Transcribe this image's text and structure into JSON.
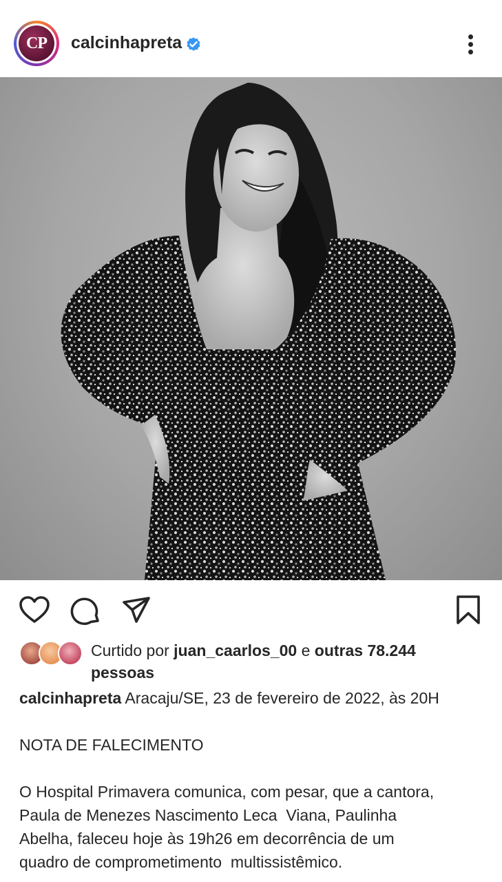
{
  "post": {
    "avatar_text": "CP",
    "username": "calcinhapreta",
    "verified_icon": "verified-badge-icon",
    "more_icon": "more-vertical-icon"
  },
  "actions": {
    "like_icon": "heart-icon",
    "comment_icon": "comment-icon",
    "share_icon": "send-icon",
    "save_icon": "bookmark-icon"
  },
  "likes": {
    "prefix": "Curtido por ",
    "user": "juan_caarlos_00",
    "middle": " e ",
    "others": "outras 78.244",
    "suffix": "pessoas"
  },
  "caption": {
    "username": "calcinhapreta",
    "first_line": " Aracaju/SE, 23 de fevereiro de 2022, às 20H",
    "heading": "NOTA DE FALECIMENTO",
    "body_lines": [
      "O Hospital Primavera comunica, com pesar, que a cantora,",
      "Paula de Menezes Nascimento Leca  Viana, Paulinha",
      "Abelha, faleceu hoje às 19h26 em decorrência de um",
      "quadro de comprometimento  multissistêmico."
    ]
  },
  "colors": {
    "text": "#262626",
    "verified": "#3897f0"
  }
}
